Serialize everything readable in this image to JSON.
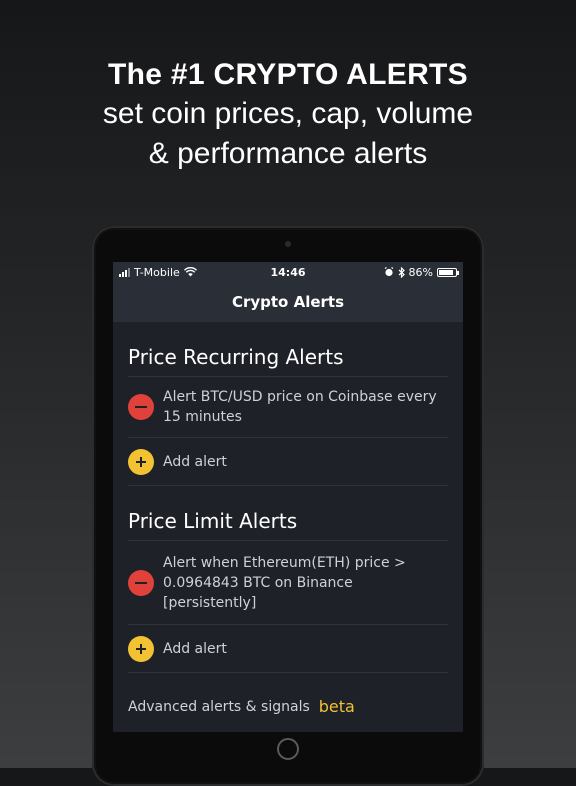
{
  "promo": {
    "line1": "The #1 CRYPTO ALERTS",
    "line2": "set coin prices, cap, volume",
    "line3": "& performance alerts"
  },
  "status_bar": {
    "carrier": "T-Mobile",
    "time": "14:46",
    "battery": "86%",
    "battery_level": 0.86
  },
  "nav": {
    "title": "Crypto Alerts"
  },
  "sections": [
    {
      "title": "Price Recurring Alerts",
      "alert_text": "Alert BTC/USD price on Coinbase every 15 minutes",
      "add_label": "Add alert"
    },
    {
      "title": "Price Limit Alerts",
      "alert_text": "Alert when Ethereum(ETH) price > 0.0964843 BTC on Binance [persistently]",
      "add_label": "Add alert"
    }
  ],
  "footer": {
    "label": "Advanced alerts & signals",
    "badge": "beta"
  },
  "colors": {
    "delete": "#e0423b",
    "add": "#f3c232",
    "accent": "#f3c232",
    "background": "#1e2128",
    "bar": "#2a2e36"
  },
  "icons": [
    "wifi-icon",
    "alarm-icon",
    "bluetooth-icon",
    "battery-icon",
    "minus-circle-icon",
    "plus-circle-icon"
  ]
}
